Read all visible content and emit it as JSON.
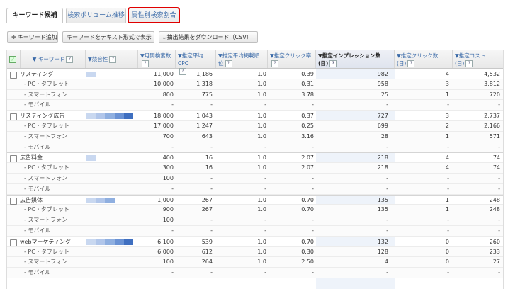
{
  "tabs": [
    {
      "label": "キーワード候補"
    },
    {
      "label": "検索ボリューム推移"
    },
    {
      "label": "属性別検索割合"
    }
  ],
  "toolbar": {
    "add": "キーワード追加",
    "text_view": "キーワードをテキスト形式で表示",
    "download": "抽出結果をダウンロード（CSV）"
  },
  "columns": {
    "keyword": "キーワード",
    "competition": "競合性",
    "monthly": "月間検索数",
    "cpc": "推定平均CPC",
    "pos": "推定平均掲載順",
    "pos2": "位",
    "ctr": "推定クリック率",
    "imp": "推定インプレッション数",
    "imp2": "(日)",
    "clicks": "推定クリック数",
    "clicks2": "(日)",
    "cost": "推定コスト",
    "cost2": "(日)"
  },
  "rows": [
    {
      "type": "main",
      "kw": "リスティング",
      "comp": 1,
      "monthly": "11,000",
      "cpc": "1,186",
      "pos": "1.0",
      "ctr": "0.39",
      "imp": "982",
      "clk": "4",
      "cost": "4,532"
    },
    {
      "type": "sub",
      "kw": "- PC・タブレット",
      "monthly": "10,000",
      "cpc": "1,318",
      "pos": "1.0",
      "ctr": "0.31",
      "imp": "958",
      "clk": "3",
      "cost": "3,812"
    },
    {
      "type": "sub",
      "kw": "- スマートフォン",
      "monthly": "800",
      "cpc": "775",
      "pos": "1.0",
      "ctr": "3.78",
      "imp": "25",
      "clk": "1",
      "cost": "720"
    },
    {
      "type": "sub",
      "kw": "- モバイル",
      "monthly": "-",
      "cpc": "-",
      "pos": "-",
      "ctr": "-",
      "imp": "-",
      "clk": "-",
      "cost": "-"
    },
    {
      "type": "main",
      "kw": "リスティング広告",
      "comp": 5,
      "monthly": "18,000",
      "cpc": "1,043",
      "pos": "1.0",
      "ctr": "0.37",
      "imp": "727",
      "clk": "3",
      "cost": "2,737"
    },
    {
      "type": "sub",
      "kw": "- PC・タブレット",
      "monthly": "17,000",
      "cpc": "1,247",
      "pos": "1.0",
      "ctr": "0.25",
      "imp": "699",
      "clk": "2",
      "cost": "2,166"
    },
    {
      "type": "sub",
      "kw": "- スマートフォン",
      "monthly": "700",
      "cpc": "643",
      "pos": "1.0",
      "ctr": "3.16",
      "imp": "28",
      "clk": "1",
      "cost": "571"
    },
    {
      "type": "sub",
      "kw": "- モバイル",
      "monthly": "-",
      "cpc": "-",
      "pos": "-",
      "ctr": "-",
      "imp": "-",
      "clk": "-",
      "cost": "-"
    },
    {
      "type": "main",
      "kw": "広告料金",
      "comp": 1,
      "monthly": "400",
      "cpc": "16",
      "pos": "1.0",
      "ctr": "2.07",
      "imp": "218",
      "clk": "4",
      "cost": "74"
    },
    {
      "type": "sub",
      "kw": "- PC・タブレット",
      "monthly": "300",
      "cpc": "16",
      "pos": "1.0",
      "ctr": "2.07",
      "imp": "218",
      "clk": "4",
      "cost": "74"
    },
    {
      "type": "sub",
      "kw": "- スマートフォン",
      "monthly": "100",
      "cpc": "-",
      "pos": "-",
      "ctr": "-",
      "imp": "-",
      "clk": "-",
      "cost": "-"
    },
    {
      "type": "sub",
      "kw": "- モバイル",
      "monthly": "-",
      "cpc": "-",
      "pos": "-",
      "ctr": "-",
      "imp": "-",
      "clk": "-",
      "cost": "-"
    },
    {
      "type": "main",
      "kw": "広告媒体",
      "comp": 3,
      "monthly": "1,000",
      "cpc": "267",
      "pos": "1.0",
      "ctr": "0.70",
      "imp": "135",
      "clk": "1",
      "cost": "248"
    },
    {
      "type": "sub",
      "kw": "- PC・タブレット",
      "monthly": "900",
      "cpc": "267",
      "pos": "1.0",
      "ctr": "0.70",
      "imp": "135",
      "clk": "1",
      "cost": "248"
    },
    {
      "type": "sub",
      "kw": "- スマートフォン",
      "monthly": "100",
      "cpc": "-",
      "pos": "-",
      "ctr": "-",
      "imp": "-",
      "clk": "-",
      "cost": "-"
    },
    {
      "type": "sub",
      "kw": "- モバイル",
      "monthly": "-",
      "cpc": "-",
      "pos": "-",
      "ctr": "-",
      "imp": "-",
      "clk": "-",
      "cost": "-"
    },
    {
      "type": "main",
      "kw": "webマーケティング",
      "comp": 5,
      "monthly": "6,100",
      "cpc": "539",
      "pos": "1.0",
      "ctr": "0.70",
      "imp": "132",
      "clk": "0",
      "cost": "260"
    },
    {
      "type": "sub",
      "kw": "- PC・タブレット",
      "monthly": "6,000",
      "cpc": "612",
      "pos": "1.0",
      "ctr": "0.30",
      "imp": "128",
      "clk": "0",
      "cost": "233"
    },
    {
      "type": "sub",
      "kw": "- スマートフォン",
      "monthly": "100",
      "cpc": "264",
      "pos": "1.0",
      "ctr": "2.50",
      "imp": "4",
      "clk": "0",
      "cost": "27"
    },
    {
      "type": "sub",
      "kw": "- モバイル",
      "monthly": "-",
      "cpc": "-",
      "pos": "-",
      "ctr": "-",
      "imp": "-",
      "clk": "-",
      "cost": "-"
    }
  ],
  "colors": {
    "bar": [
      "#c9d8f0",
      "#b1c6ea",
      "#8fafe0",
      "#6a92d4",
      "#3f6fc0"
    ],
    "highlight": "#e00000"
  }
}
